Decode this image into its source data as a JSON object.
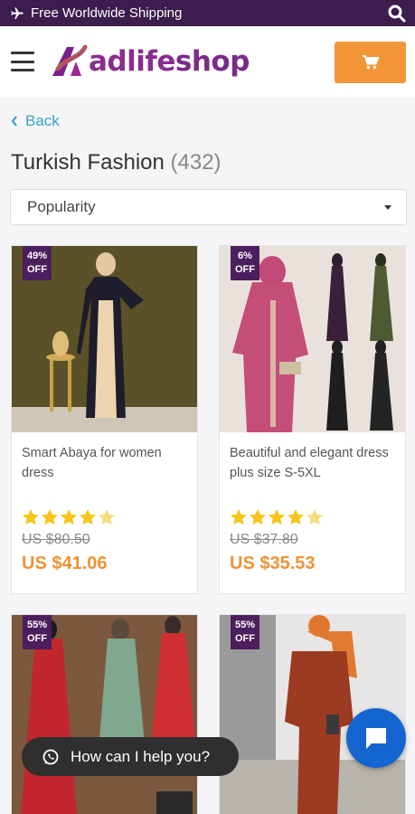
{
  "topbar": {
    "shipping_text": "Free Worldwide Shipping",
    "icon": "airplane-icon",
    "search_icon": "search-icon"
  },
  "header": {
    "logo_prefix": "adlife",
    "logo_suffix": "shop",
    "menu_icon": "hamburger-icon",
    "cart_icon": "cart-icon"
  },
  "nav": {
    "back_label": "Back"
  },
  "category": {
    "title": "Turkish Fashion",
    "count": "(432)"
  },
  "sort": {
    "selected": "Popularity"
  },
  "products": [
    {
      "discount_pct": "49%",
      "discount_label": "OFF",
      "name": "Smart Abaya for women dress",
      "rating": 4.5,
      "old_price": "US $80.50",
      "price": "US $41.06"
    },
    {
      "discount_pct": "6%",
      "discount_label": "OFF",
      "name": "Beautiful and elegant dress plus size S-5XL",
      "rating": 4.5,
      "old_price": "US $37.80",
      "price": "US $35.53"
    },
    {
      "discount_pct": "55%",
      "discount_label": "OFF"
    },
    {
      "discount_pct": "55%",
      "discount_label": "OFF"
    }
  ],
  "chat": {
    "prompt": "How can I help you?",
    "whatsapp_icon": "whatsapp-icon",
    "fab_icon": "chat-bubble-icon"
  },
  "colors": {
    "topbar": "#3c1d4e",
    "accent": "#f39638",
    "badge": "#4b1f5d",
    "price": "#ef9234",
    "link": "#3aa0c8",
    "star": "#f5c518",
    "fab": "#1565d0"
  }
}
